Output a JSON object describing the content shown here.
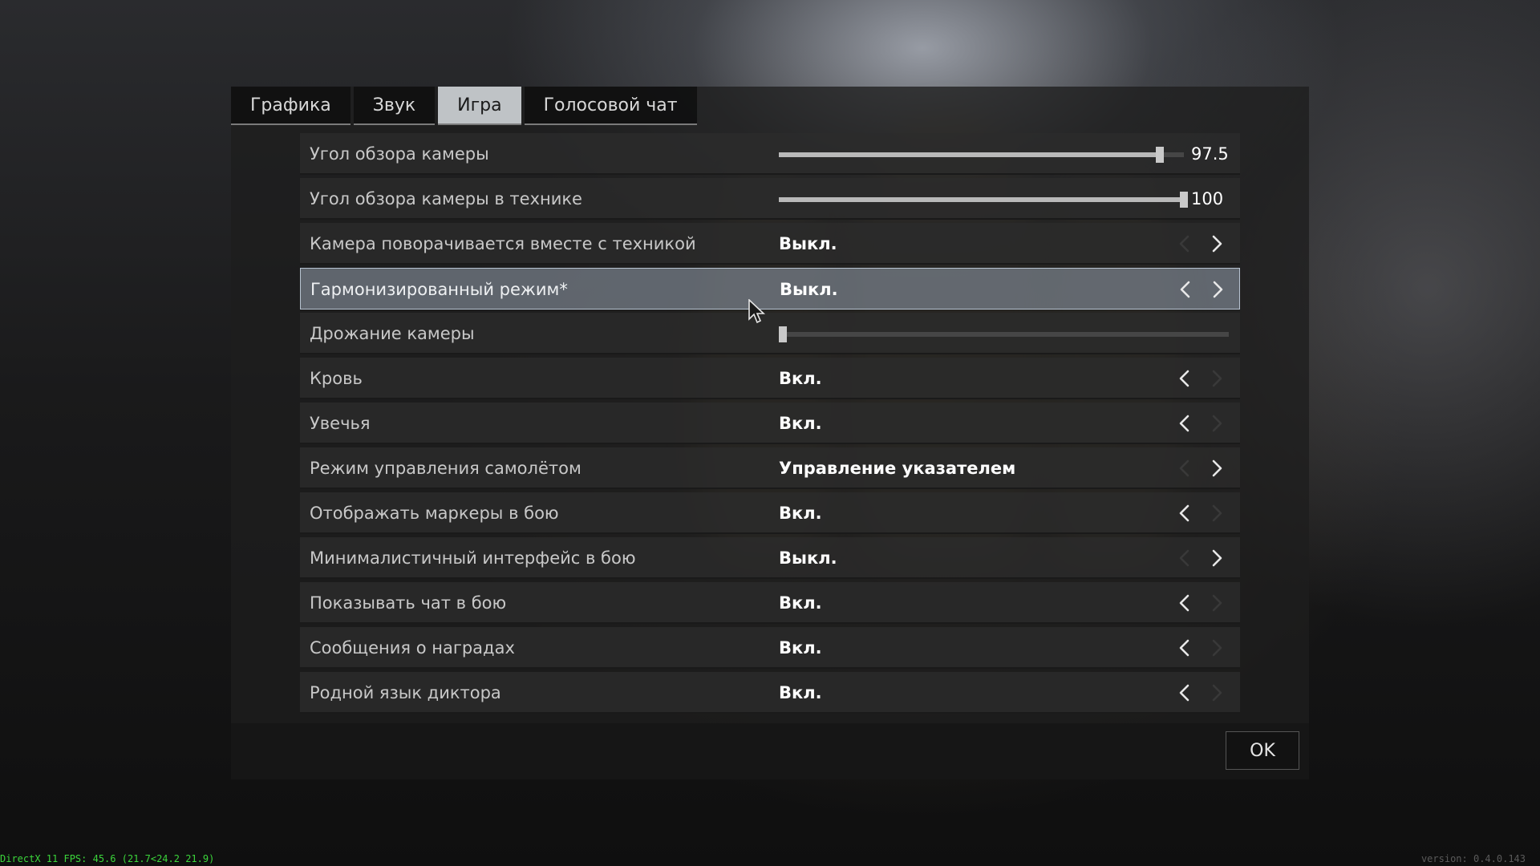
{
  "tabs": [
    {
      "label": "Графика",
      "active": false
    },
    {
      "label": "Звук",
      "active": false
    },
    {
      "label": "Игра",
      "active": true
    },
    {
      "label": "Голосовой чат",
      "active": false
    }
  ],
  "settings": [
    {
      "label": "Угол обзора камеры",
      "type": "slider",
      "value": 0.94,
      "readout": "97.5"
    },
    {
      "label": "Угол обзора камеры в технике",
      "type": "slider",
      "value": 1.0,
      "readout": "100"
    },
    {
      "label": "Камера поворачивается вместе с техникой",
      "type": "select",
      "value": "Выкл.",
      "prev": false,
      "next": true
    },
    {
      "label": "Гармонизированный режим*",
      "type": "select",
      "value": "Выкл.",
      "prev": true,
      "next": true,
      "highlighted": true
    },
    {
      "label": "Дрожание камеры",
      "type": "slider",
      "value": 0.0,
      "readout": ""
    },
    {
      "label": "Кровь",
      "type": "select",
      "value": "Вкл.",
      "prev": true,
      "next": false
    },
    {
      "label": "Увечья",
      "type": "select",
      "value": "Вкл.",
      "prev": true,
      "next": false
    },
    {
      "label": "Режим управления самолётом",
      "type": "select",
      "value": "Управление указателем",
      "prev": false,
      "next": true
    },
    {
      "label": "Отображать маркеры в бою",
      "type": "select",
      "value": "Вкл.",
      "prev": true,
      "next": false
    },
    {
      "label": "Минималистичный интерфейс в бою",
      "type": "select",
      "value": "Выкл.",
      "prev": false,
      "next": true
    },
    {
      "label": "Показывать чат в бою",
      "type": "select",
      "value": "Вкл.",
      "prev": true,
      "next": false
    },
    {
      "label": "Сообщения о наградах",
      "type": "select",
      "value": "Вкл.",
      "prev": true,
      "next": false
    },
    {
      "label": "Родной язык диктора",
      "type": "select",
      "value": "Вкл.",
      "prev": true,
      "next": false
    }
  ],
  "footer": {
    "ok_label": "OK"
  },
  "overlay": {
    "fps": "DirectX 11 FPS: 45.6 (21.7<24.2 21.9)",
    "version": "version: 0.4.0.143"
  },
  "colors": {
    "active_tab": "#bfc3c6",
    "highlight_row": "#96a0af",
    "fps_text": "#3bd53b"
  }
}
